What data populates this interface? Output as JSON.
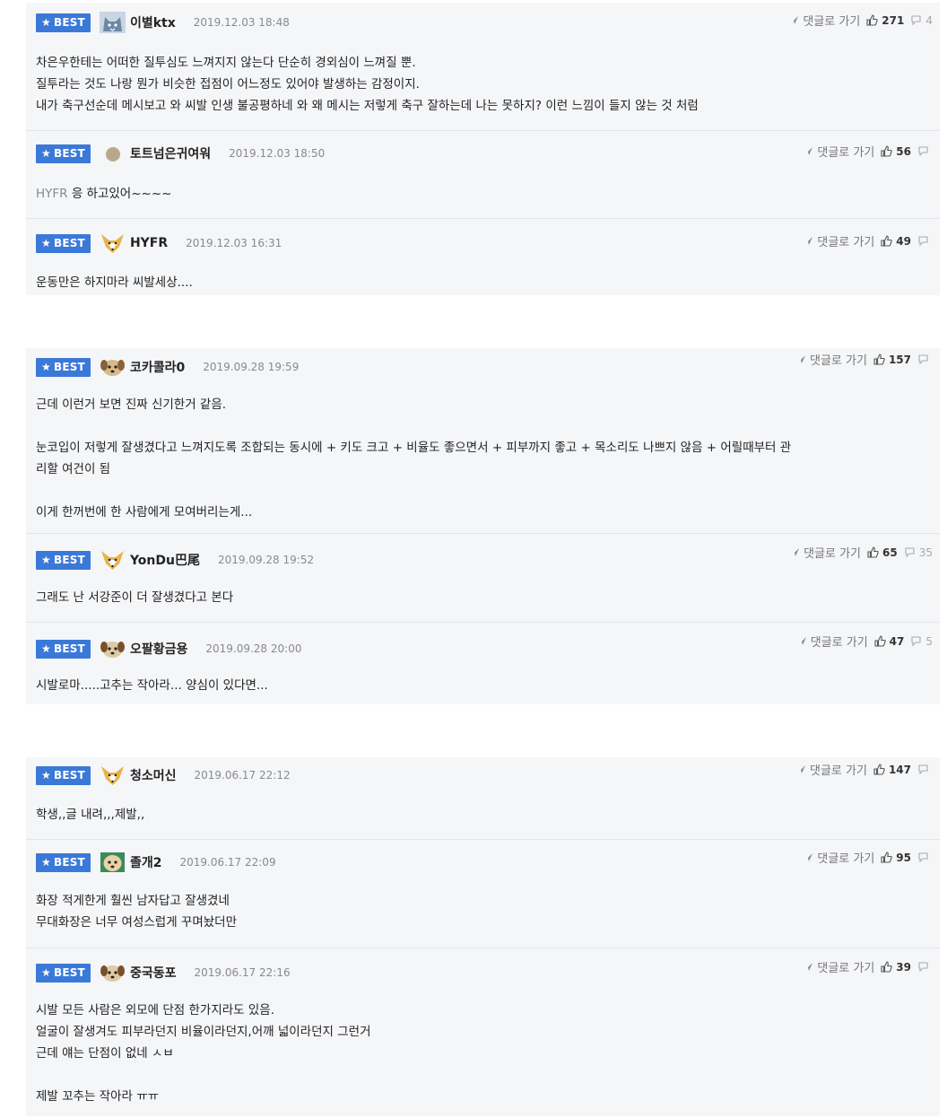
{
  "reply_label": "댓글로 가기",
  "badge_label": "BEST",
  "groups": [
    {
      "comments": [
        {
          "nick": "이별ktx",
          "date": "2019.12.03 18:48",
          "up": "271",
          "down": "4",
          "avatar": "husky-avatar",
          "lines": [
            "차은우한테는 어떠한 질투심도 느껴지지 않는다 단순히 경외심이 느껴질 뿐.",
            "질투라는 것도 나랑 뭔가 비슷한 접점이 어느정도 있어야 발생하는 감정이지.",
            "내가 축구선순데 메시보고 와 씨발 인생 불공평하네 와 왜 메시는 저렇게 축구 잘하는데 나는 못하지? 이런 느낌이 들지 않는 것 처럼"
          ]
        },
        {
          "nick": "토트넘은귀여워",
          "date": "2019.12.03 18:50",
          "up": "56",
          "down": "",
          "avatar": "dot-avatar",
          "body_mention": "HYFR",
          "body_rest": " 응 하고있어~~~~"
        },
        {
          "nick": "HYFR",
          "date": "2019.12.03 16:31",
          "up": "49",
          "down": "",
          "avatar": "fox-avatar",
          "lines": [
            "운동만은 하지마라 씨발세상...."
          ]
        }
      ]
    },
    {
      "comments": [
        {
          "nick": "코카콜라0",
          "date": "2019.09.28 19:59",
          "up": "157",
          "down": "",
          "avatar": "dog-avatar",
          "lines": [
            "근데 이런거 보면 진짜 신기한거 같음.",
            "",
            "눈코입이 저렇게 잘생겼다고 느껴지도록 조합되는 동시에 + 키도 크고 + 비율도 좋으면서 + 피부까지 좋고 + 목소리도 나쁘지 않음 + 어릴때부터 관",
            "리할 여건이 됨",
            "",
            "이게 한꺼번에 한 사람에게 모여버리는게..."
          ]
        },
        {
          "nick": "YonDu巴尾",
          "date": "2019.09.28 19:52",
          "up": "65",
          "down": "35",
          "avatar": "fox-avatar",
          "lines": [
            "그래도 난 서강준이 더 잘생겼다고 본다"
          ]
        },
        {
          "nick": "오팔황금용",
          "date": "2019.09.28 20:00",
          "up": "47",
          "down": "5",
          "avatar": "dog-avatar",
          "lines": [
            "시발로마.....고추는 작아라... 양심이 있다면..."
          ]
        }
      ]
    },
    {
      "comments": [
        {
          "nick": "청소머신",
          "date": "2019.06.17 22:12",
          "up": "147",
          "down": "",
          "avatar": "fox-avatar",
          "lines": [
            "학생,,글 내려,,,제발,,"
          ]
        },
        {
          "nick": "졸개2",
          "date": "2019.06.17 22:09",
          "up": "95",
          "down": "",
          "avatar": "dog-avatar",
          "lines": [
            "화장 적게한게 훨씬 남자답고 잘생겼네",
            "무대화장은 너무 여성스럽게 꾸며놨더만"
          ]
        },
        {
          "nick": "중국동포",
          "date": "2019.06.17 22:16",
          "up": "39",
          "down": "",
          "avatar": "dog-avatar",
          "lines": [
            "시발 모든 사람은 외모에 단점 한가지라도 있음.",
            "얼굴이 잘생겨도 피부라던지 비율이라던지,어깨 넓이라던지 그런거",
            "근데 얘는 단점이 없네 ㅅㅂ",
            "",
            "제발 꼬추는 작아라 ㅠㅠ"
          ]
        }
      ]
    }
  ]
}
